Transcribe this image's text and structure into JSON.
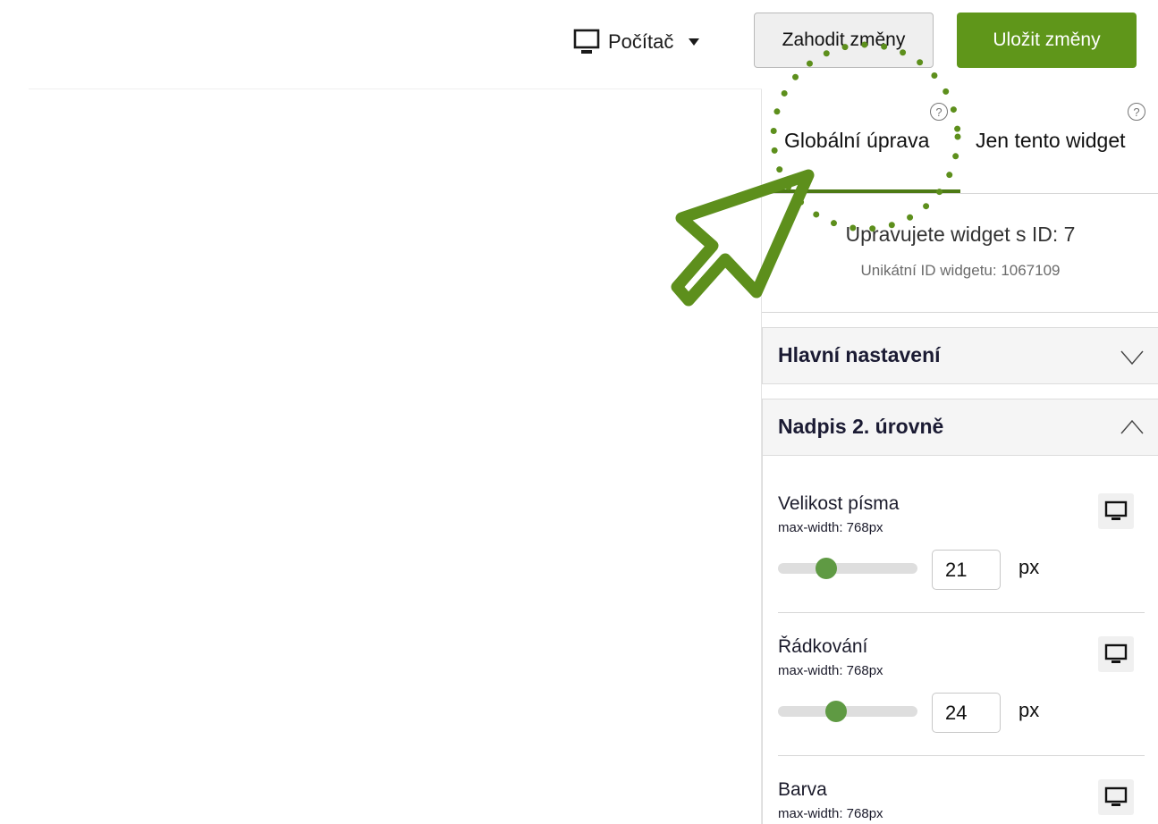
{
  "topbar": {
    "device_selector": {
      "label": "Počítač",
      "icon": "monitor-icon",
      "caret_icon": "caret-down-icon"
    },
    "discard_label": "Zahodit změny",
    "save_label": "Uložit změny"
  },
  "colors": {
    "accent": "#5f961a",
    "tab_underline": "#4d7a15",
    "slider_thumb": "#5f9a43",
    "annotation": "#5d8f1c"
  },
  "panel": {
    "tabs": [
      {
        "label": "Globální úprava",
        "help_icon": "help-circle-icon",
        "help_text": "?",
        "active": true
      },
      {
        "label": "Jen tento widget",
        "help_icon": "help-circle-icon",
        "help_text": "?",
        "active": false
      }
    ],
    "widget_info": {
      "title": "Upravujete widget s ID: 7",
      "unique_id": "Unikátní ID widgetu: 1067109"
    },
    "sections": [
      {
        "label": "Hlavní nastavení",
        "expanded": false,
        "icon": "chevron-down-icon"
      },
      {
        "label": "Nadpis 2. úrovně",
        "expanded": true,
        "icon": "chevron-up-icon"
      }
    ],
    "settings": [
      {
        "name": "Velikost písma",
        "media": "max-width: 768px",
        "value": "21",
        "unit": "px",
        "slider_fraction": 0.32,
        "device_icon": "monitor-icon"
      },
      {
        "name": "Řádkování",
        "media": "max-width: 768px",
        "value": "24",
        "unit": "px",
        "slider_fraction": 0.4,
        "device_icon": "monitor-icon"
      },
      {
        "name": "Barva",
        "media": "max-width: 768px",
        "device_icon": "monitor-icon"
      }
    ]
  },
  "annotation": {
    "icon": "cursor-arrow-icon",
    "highlight": "dotted-circle"
  }
}
